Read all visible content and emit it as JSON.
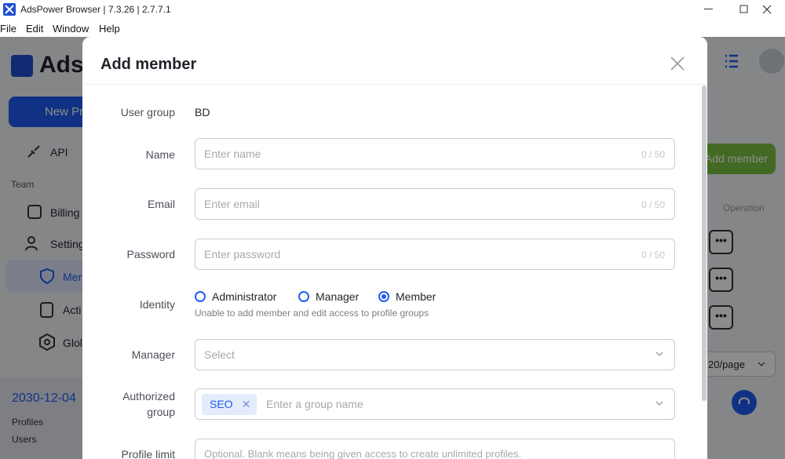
{
  "window": {
    "title": "AdsPower Browser | 7.3.26 | 2.7.7.1",
    "minimize": "—",
    "maximize": "☐",
    "close": "✕"
  },
  "menu": [
    "File",
    "Edit",
    "Window",
    "Help"
  ],
  "app": {
    "logo_text": "Ads",
    "new_profile": "New Pr",
    "sidebar": {
      "api": "API",
      "team_label": "Team",
      "billing": "Billing",
      "settings": "Setting",
      "members": "Mer",
      "actions": "Acti",
      "global": "Glol"
    },
    "bottom": {
      "date": "2030-12-04",
      "profiles": "Profiles",
      "users": "Users"
    },
    "add_member_button": "Add member",
    "operation_header": "Operation",
    "row_action": "•••",
    "pager": "20/page"
  },
  "modal": {
    "title": "Add member",
    "user_group_label": "User group",
    "user_group_value": "BD",
    "name_label": "Name",
    "name_placeholder": "Enter name",
    "name_counter": "0 / 50",
    "email_label": "Email",
    "email_placeholder": "Enter email",
    "email_counter": "0 / 50",
    "password_label": "Password",
    "password_placeholder": "Enter password",
    "password_counter": "0 / 50",
    "identity_label": "Identity",
    "identity_options": [
      "Administrator",
      "Manager",
      "Member"
    ],
    "identity_selected": "Member",
    "identity_hint": "Unable to add member and edit access to profile groups",
    "manager_label": "Manager",
    "manager_placeholder": "Select",
    "authorized_group_label_1": "Authorized",
    "authorized_group_label_2": "group",
    "authorized_group_tag": "SEO",
    "authorized_group_placeholder": "Enter a group name",
    "profile_limit_label": "Profile limit",
    "profile_limit_placeholder": "Optional. Blank means being given access to create unlimited profiles."
  },
  "colors": {
    "accent": "#1f5cf0",
    "add_member_green": "#7ac143"
  }
}
